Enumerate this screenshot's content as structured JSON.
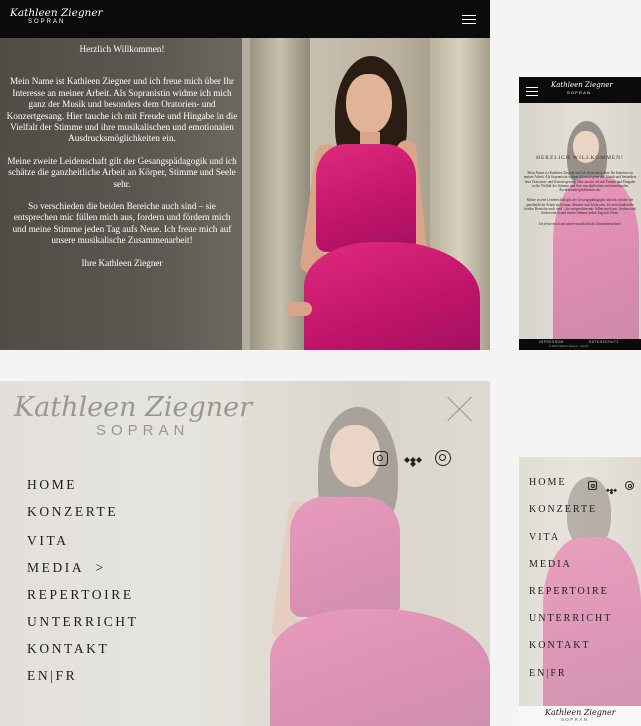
{
  "brand": {
    "name": "Kathleen Ziegner",
    "subtitle": "SOPRAN"
  },
  "home": {
    "greeting": "Herzlich Willkommen!",
    "paragraphs": [
      "Mein Name ist Kathleen Ziegner und ich freue mich über Ihr Interesse an meiner Arbeit. Als Sopranistin widme ich mich ganz der Musik und besonders dem Oratorien- und Konzertgesang. Hier tauche ich mit Freude und Hingabe in die Vielfalt der Stimme und ihre musikalischen und emotionalen Ausdrucksmöglichkeiten ein.",
      "Meine zweite Leidenschaft gilt der Gesangspädagogik und ich schätze die ganzheitliche Arbeit an Körper, Stimme und Seele sehr.",
      "So verschieden die beiden Bereiche auch sind – sie entsprechen mic füllen mich aus, fordern und fördern mich und meine Stimme jeden Tag aufs Neue. Ich freue mich auf unsere musikalische Zusammenarbeit!"
    ],
    "signature": "Ihre Kathleen Ziegner"
  },
  "mobile_home": {
    "greeting": "HERZLICH WILLKOMMEN!",
    "paragraphs": [
      "Mein Name ist Kathleen Ziegner und ich freue mich über Ihr Interesse an meiner Arbeit. Als Sopranistin widme ich mich ganz der Musik und besonders dem Oratorien- und Konzertgesang. Hier tauche ich mit Freude und Hingabe in die Vielfalt der Stimme und ihre musikalischen und emotionalen Ausdrucksmöglichkeiten ein.",
      "Meine zweite Leidenschaft gilt der Gesangspädagogik und ich schätze die ganzheitliche Arbeit an Körper, Stimme und Seele sehr. So verschieden die beiden Bereiche auch sind – sie entsprechen mic füllen mich aus, fordern und fördern mich und meine Stimme jeden Tag aufs Neue.",
      "Ich freue mich auf unsere musikalische Zusammenarbeit!"
    ],
    "footer_links": [
      "IMPRESSUM",
      "DATENSCHUTZ"
    ],
    "copyright": "© 2024 Kathleen Ziegner · Sopran"
  },
  "menu": {
    "items": [
      "HOME",
      "KONZERTE",
      "VITA",
      "MEDIA",
      "REPERTOIRE",
      "UNTERRICHT",
      "KONTAKT",
      "EN|FR"
    ],
    "media_chevron": ">",
    "social_icons": [
      "instagram-icon",
      "tidal-icon",
      "music-streaming-icon"
    ]
  },
  "colors": {
    "topbar": "#0b0b0b",
    "dress": "#d0187a",
    "overlay_dark": "#504c46"
  }
}
